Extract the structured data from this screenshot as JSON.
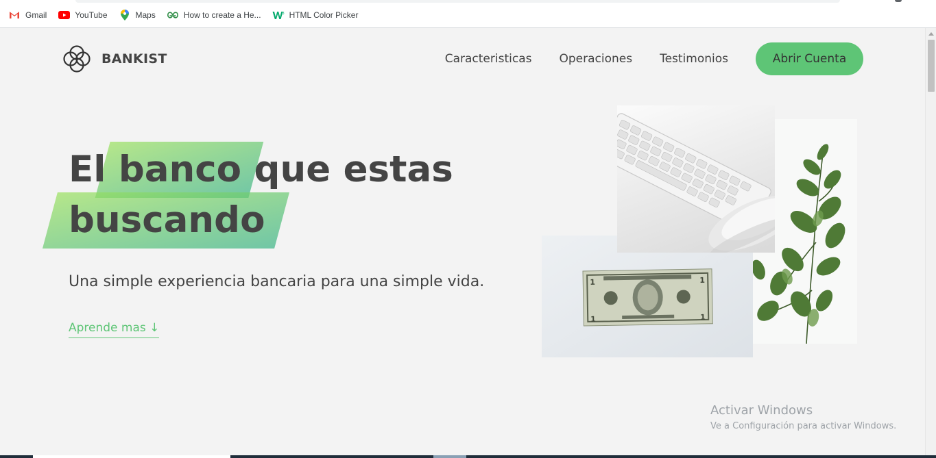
{
  "bookmarks": [
    {
      "label": "Gmail",
      "icon": "gmail-icon"
    },
    {
      "label": "YouTube",
      "icon": "youtube-icon"
    },
    {
      "label": "Maps",
      "icon": "maps-icon"
    },
    {
      "label": "How to create a He...",
      "icon": "geeksforgeeks-icon"
    },
    {
      "label": "HTML Color Picker",
      "icon": "w3schools-icon"
    }
  ],
  "nav": {
    "brand": "BANKIST",
    "links": [
      "Caracteristicas",
      "Operaciones",
      "Testimonios"
    ],
    "cta": "Abrir Cuenta"
  },
  "hero": {
    "title_pre": "El",
    "title_highlight1": "banco",
    "title_post": "que estas",
    "title_highlight2": "buscando",
    "subtitle": "Una simple experiencia bancaria para una simple vida.",
    "learn_more": "Aprende mas ↓"
  },
  "watermark": {
    "title": "Activar Windows",
    "subtitle": "Ve a Configuración para activar Windows."
  },
  "colors": {
    "primary": "#5ec576",
    "text": "#444444",
    "background": "#f3f3f3"
  }
}
